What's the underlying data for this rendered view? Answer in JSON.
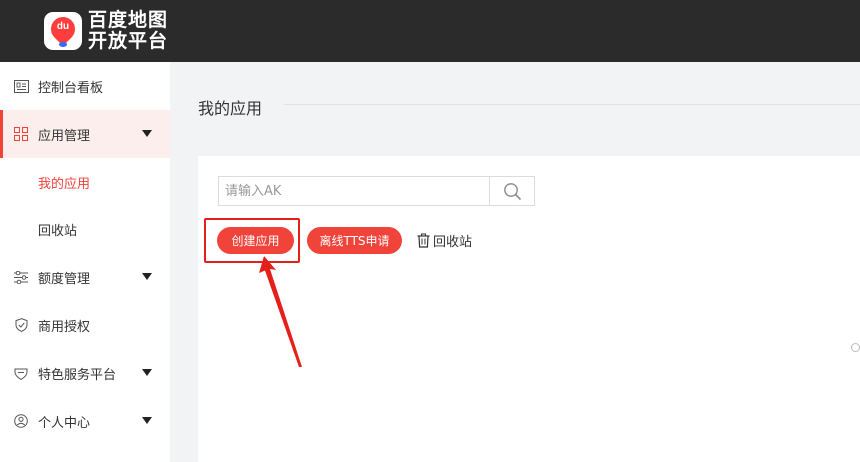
{
  "header": {
    "brand_line1": "百度地图",
    "brand_line2": "开放平台",
    "logo_text": "du",
    "bg_color": "#2b2b2b"
  },
  "sidebar": {
    "items": [
      {
        "label": "控制台看板",
        "icon": "dashboard-icon"
      },
      {
        "label": "应用管理",
        "icon": "grid-icon",
        "expanded": true,
        "active": true
      },
      {
        "label": "额度管理",
        "icon": "sliders-icon",
        "expanded": false
      },
      {
        "label": "商用授权",
        "icon": "shield-check-icon"
      },
      {
        "label": "特色服务平台",
        "icon": "heart-shield-icon",
        "expanded": false
      },
      {
        "label": "个人中心",
        "icon": "user-icon",
        "expanded": false
      }
    ],
    "sub_items": [
      {
        "label": "我的应用",
        "active": true
      },
      {
        "label": "回收站"
      }
    ]
  },
  "main": {
    "page_title": "我的应用",
    "search": {
      "placeholder": "请输入AK",
      "value": ""
    },
    "buttons": {
      "create": "创建应用",
      "offline_tts": "离线TTS申请",
      "recycle": "回收站"
    }
  },
  "annotation": {
    "highlight_color": "#e5201a"
  },
  "colors": {
    "accent": "#f0433a",
    "active_bg": "#fdeeee"
  }
}
